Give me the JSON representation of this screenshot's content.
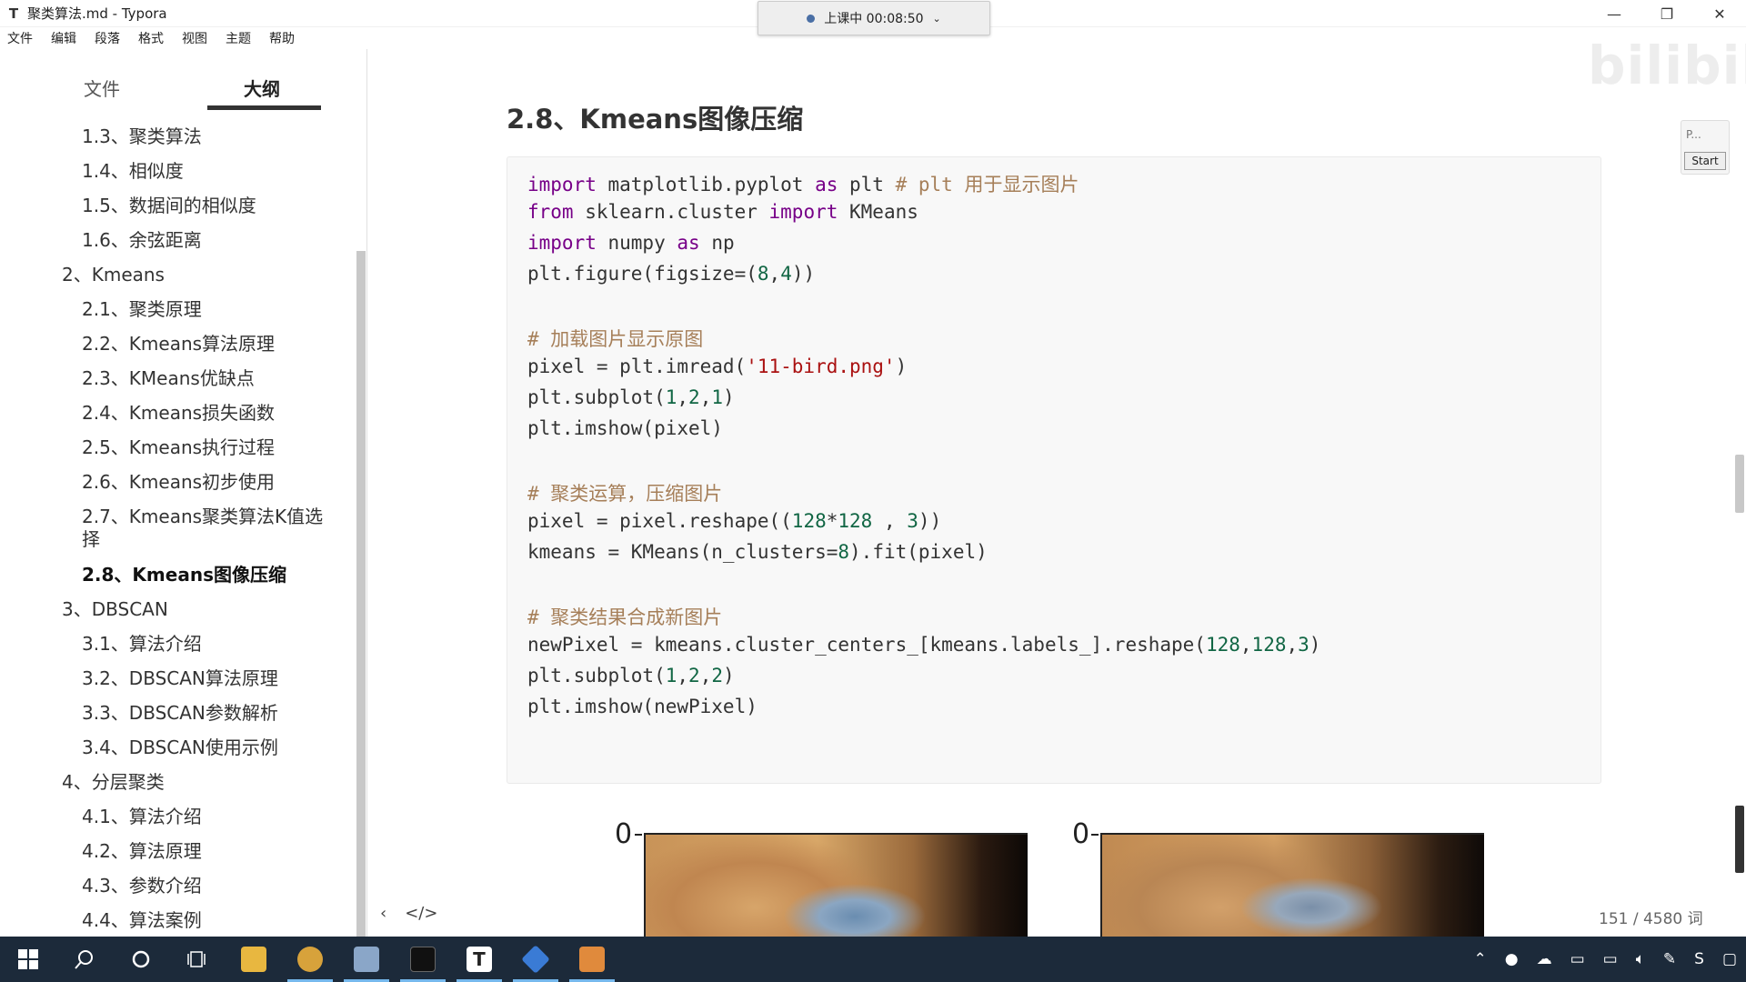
{
  "window": {
    "app_icon": "T",
    "title": "聚类算法.md - Typora",
    "minimize": "—",
    "maximize": "❐",
    "close": "✕"
  },
  "recording": {
    "label": "上课中 00:08:50"
  },
  "menu": [
    "文件",
    "编辑",
    "段落",
    "格式",
    "视图",
    "主题",
    "帮助"
  ],
  "sidebar": {
    "tab_files": "文件",
    "tab_outline": "大纲",
    "items": [
      "1.3、聚类算法",
      "1.4、相似度",
      "1.5、数据间的相似度",
      "1.6、余弦距离",
      "2、Kmeans",
      "2.1、聚类原理",
      "2.2、Kmeans算法原理",
      "2.3、KMeans优缺点",
      "2.4、Kmeans损失函数",
      "2.5、Kmeans执行过程",
      "2.6、Kmeans初步使用",
      "2.7、Kmeans聚类算法K值选",
      "择",
      "2.8、Kmeans图像压缩",
      "3、DBSCAN",
      "3.1、算法介绍",
      "3.2、DBSCAN算法原理",
      "3.3、DBSCAN参数解析",
      "3.4、DBSCAN使用示例",
      "4、分层聚类",
      "4.1、算法介绍",
      "4.2、算法原理",
      "4.3、参数介绍",
      "4.4、算法案例"
    ]
  },
  "document": {
    "heading": "2.8、Kmeans图像压缩",
    "code_lines": [
      "import matplotlib.pyplot as plt # plt 用于显示图片",
      "from sklearn.cluster import KMeans",
      "import numpy as np",
      "plt.figure(figsize=(8,4))",
      "",
      "# 加载图片显示原图",
      "pixel = plt.imread('11-bird.png')",
      "plt.subplot(1,2,1)",
      "plt.imshow(pixel)",
      "",
      "# 聚类运算，压缩图片",
      "pixel = pixel.reshape((128*128 , 3))",
      "kmeans = KMeans(n_clusters=8).fit(pixel)",
      "",
      "# 聚类结果合成新图片",
      "newPixel = kmeans.cluster_centers_[kmeans.labels_].reshape(128,128,3)",
      "plt.subplot(1,2,2)",
      "plt.imshow(newPixel)"
    ],
    "plot_tick_left": "0",
    "plot_tick_right": "0"
  },
  "footer": {
    "back": "‹",
    "source_toggle": "</>",
    "word_count": "151 / 4580 词"
  },
  "widget": {
    "label": "P...",
    "start": "Start"
  },
  "watermark": "bilibili",
  "taskbar": {
    "apps": [
      "windows-start",
      "search",
      "cortana",
      "task-view",
      "file-explorer",
      "chrome",
      "paint",
      "terminal",
      "typora",
      "vscode",
      "other-app"
    ]
  }
}
